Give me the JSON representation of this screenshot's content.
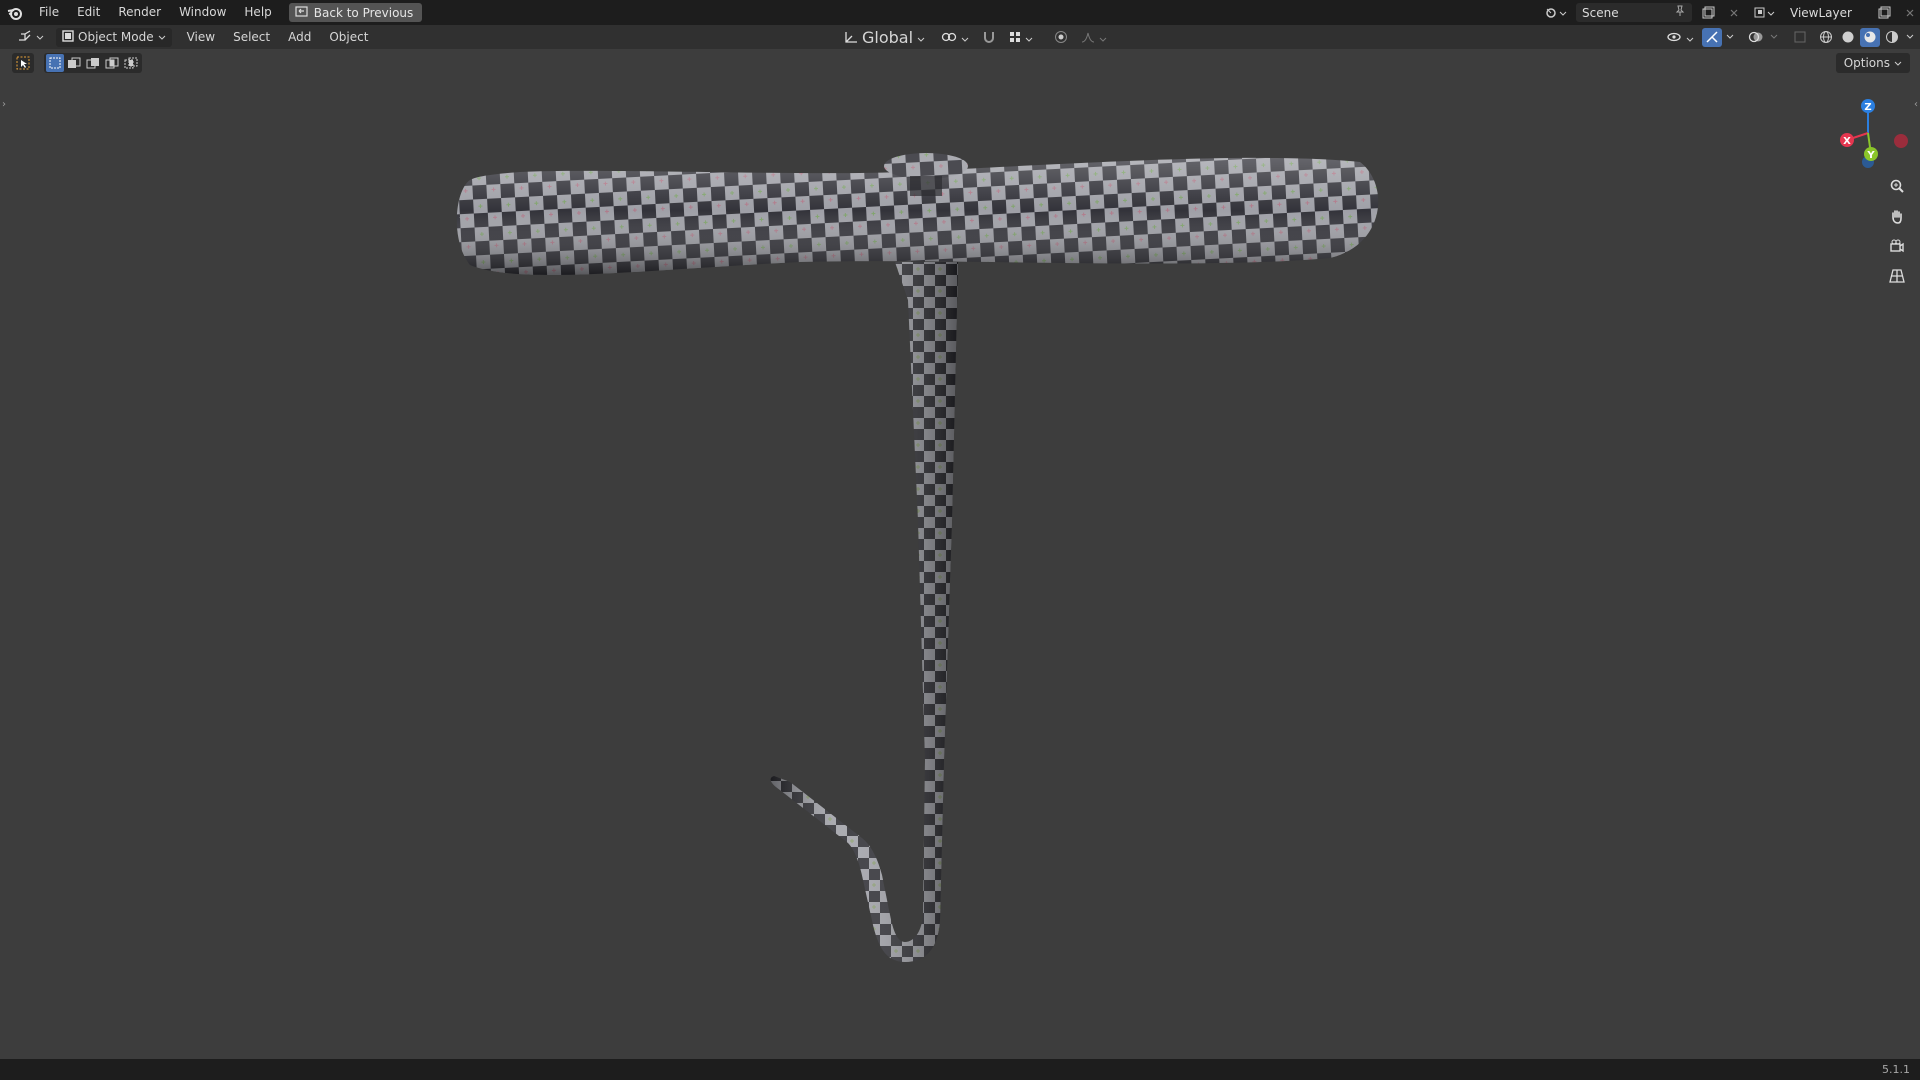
{
  "topbar": {
    "menus": [
      "File",
      "Edit",
      "Render",
      "Window",
      "Help"
    ],
    "back_button": "Back to Previous",
    "scene_name": "Scene",
    "view_layer_name": "ViewLayer"
  },
  "header": {
    "mode": "Object Mode",
    "menus": [
      "View",
      "Select",
      "Add",
      "Object"
    ],
    "transform_orientation": "Global"
  },
  "viewport": {
    "options_label": "Options",
    "gizmo": {
      "x_label": "X",
      "y_label": "Y",
      "z_label": "Z"
    }
  },
  "statusbar": {
    "version": "5.1.1"
  },
  "colors": {
    "accent": "#4772b3",
    "axis_x": "#e5364f",
    "axis_y": "#8bc52a",
    "axis_z": "#2b7fe0"
  }
}
